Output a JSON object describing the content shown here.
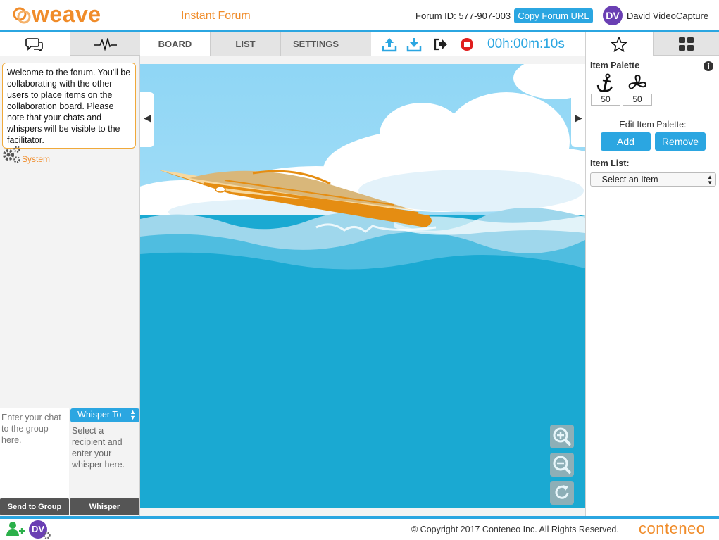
{
  "header": {
    "logo": "weave",
    "title": "Instant Forum",
    "forum_id": "Forum ID: 577-907-003",
    "copy_url": "Copy Forum URL",
    "avatar_initials": "DV",
    "user_name": "David VideoCapture"
  },
  "left": {
    "tabs": [
      {
        "icon": "chat-bubbles-icon"
      },
      {
        "icon": "activity-pulse-icon"
      }
    ],
    "message": "Welcome to the forum. You'll be collaborating with the other users to place items on the collaboration board. Please note that your chats and whispers will be visible to the facilitator.",
    "message_sender": "System",
    "chat_placeholder": "Enter your chat to the group here.",
    "whisper_select": "-Whisper To-",
    "whisper_placeholder": "Select a recipient and enter your whisper here.",
    "send_group": "Send to Group",
    "whisper_button": "Whisper"
  },
  "center": {
    "tabs": [
      "BOARD",
      "LIST",
      "SETTINGS"
    ],
    "timer": "00h:00m:10s",
    "toolbar_icons": [
      "upload-icon",
      "download-icon",
      "exit-icon",
      "stop-record-icon"
    ]
  },
  "right": {
    "tabs": [
      {
        "icon": "star-icon"
      },
      {
        "icon": "grid-icon"
      }
    ],
    "item_palette_label": "Item Palette",
    "palette_items": [
      {
        "icon": "anchor-icon",
        "count": "50"
      },
      {
        "icon": "propeller-icon",
        "count": "50"
      }
    ],
    "edit_label": "Edit Item Palette:",
    "add": "Add",
    "remove": "Remove",
    "item_list_label": "Item List:",
    "item_select": "- Select an Item -"
  },
  "footer": {
    "avatar_initials": "DV",
    "copyright": "© Copyright 2017 Conteneo Inc. All Rights Reserved.",
    "brand": "conteneo"
  },
  "colors": {
    "accent": "#2ba6e1",
    "brand_orange": "#f08c2a",
    "avatar": "#6a3fb3"
  }
}
